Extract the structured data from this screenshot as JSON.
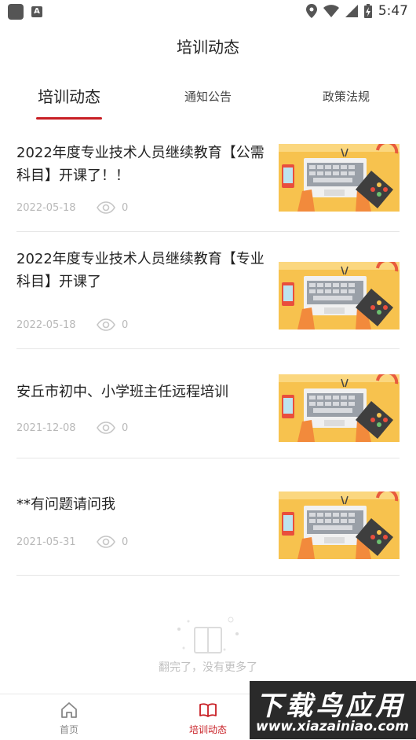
{
  "status_bar": {
    "time": "5:47",
    "notif_icon_letter": "A"
  },
  "header": {
    "title": "培训动态"
  },
  "tabs": [
    {
      "label": "培训动态",
      "active": true
    },
    {
      "label": "通知公告",
      "active": false
    },
    {
      "label": "政策法规",
      "active": false
    }
  ],
  "items": [
    {
      "title": "2022年度专业技术人员继续教育【公需科目】开课了！！",
      "date": "2022-05-18",
      "views": "0"
    },
    {
      "title": "2022年度专业技术人员继续教育【专业科目】开课了",
      "date": "2022-05-18",
      "views": "0"
    },
    {
      "title": "安丘市初中、小学班主任远程培训",
      "date": "2021-12-08",
      "views": "0"
    },
    {
      "title": "**有问题请问我",
      "date": "2021-05-31",
      "views": "0"
    }
  ],
  "end_message": "翻完了，没有更多了",
  "bottom_nav": [
    {
      "label": "首页",
      "icon": "home-icon",
      "active": false
    },
    {
      "label": "培训动态",
      "icon": "book-icon",
      "active": true
    }
  ],
  "watermark": {
    "title": "下载鸟应用",
    "url": "www.xiazainiao.com"
  },
  "colors": {
    "accent": "#c81e24",
    "thumb_bg": "#f7c24e",
    "meta": "#b8b8b8"
  }
}
